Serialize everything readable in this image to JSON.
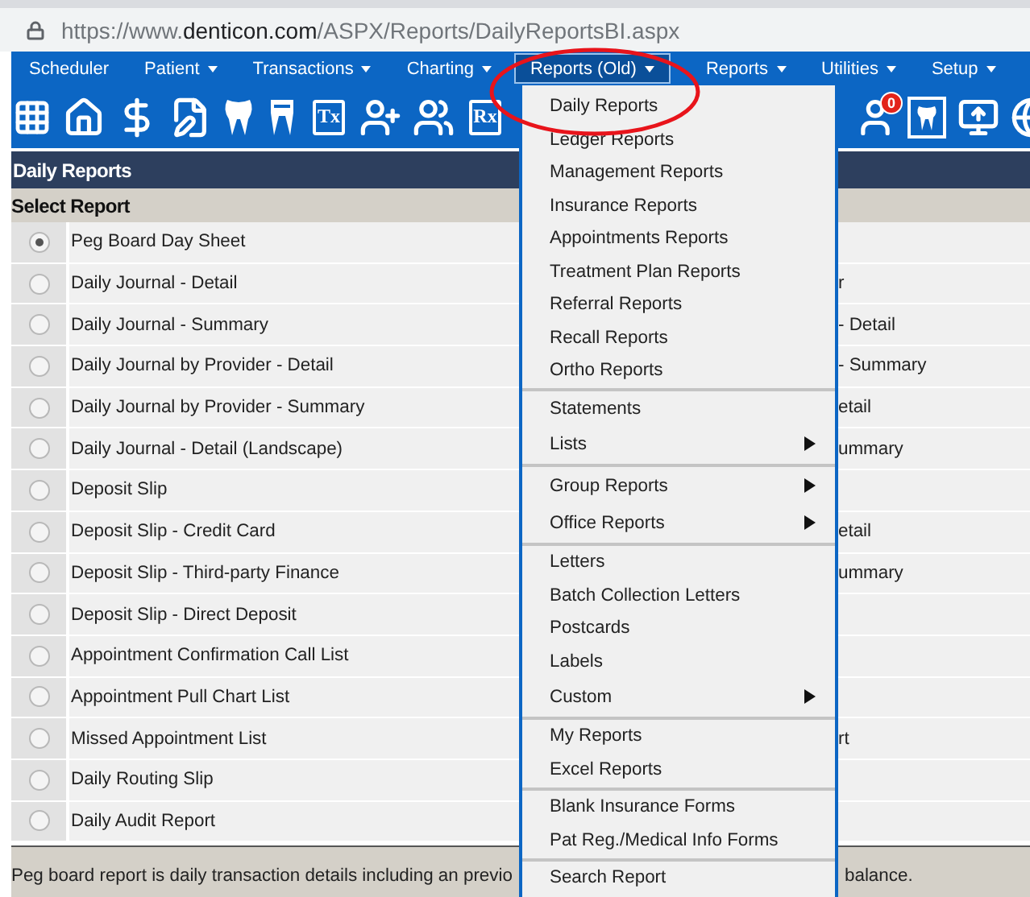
{
  "address_bar": {
    "url_parts": [
      {
        "text": "https://www.",
        "emphasis": false
      },
      {
        "text": "denticon.com",
        "emphasis": true
      },
      {
        "text": "/ASPX/Reports/DailyReportsBI.aspx",
        "emphasis": false
      }
    ]
  },
  "nav": [
    {
      "label": "Scheduler",
      "caret": false,
      "selected": false
    },
    {
      "label": "Patient",
      "caret": true,
      "selected": false
    },
    {
      "label": "Transactions",
      "caret": true,
      "selected": false
    },
    {
      "label": "Charting",
      "caret": true,
      "selected": false
    },
    {
      "label": "Reports (Old)",
      "caret": true,
      "selected": true
    },
    {
      "label": "Reports",
      "caret": true,
      "selected": false
    },
    {
      "label": "Utilities",
      "caret": true,
      "selected": false
    },
    {
      "label": "Setup",
      "caret": true,
      "selected": false
    }
  ],
  "toolbar_left": [
    {
      "kind": "calendar"
    },
    {
      "kind": "home"
    },
    {
      "kind": "dollar"
    },
    {
      "kind": "notes"
    },
    {
      "kind": "tooth"
    },
    {
      "kind": "crown"
    },
    {
      "kind": "tx",
      "label": "Tx"
    },
    {
      "kind": "user-plus"
    },
    {
      "kind": "users-plus"
    },
    {
      "kind": "rx",
      "label": "Rx"
    }
  ],
  "toolbar_right": [
    {
      "kind": "user-badge",
      "label": "0"
    },
    {
      "kind": "tooth-frame"
    },
    {
      "kind": "monitor-arrow"
    },
    {
      "kind": "globe"
    }
  ],
  "panel_title": "Daily Reports",
  "list_header": "Select Report",
  "reports": [
    {
      "label": "Peg Board Day Sheet",
      "selected": true
    },
    {
      "label": "Daily Journal - Detail",
      "selected": false,
      "column_2": "r"
    },
    {
      "label": "Daily Journal - Summary",
      "selected": false,
      "column_2": "- Detail"
    },
    {
      "label": "Daily Journal by Provider - Detail",
      "selected": false,
      "column_2": "- Summary"
    },
    {
      "label": "Daily Journal by Provider - Summary",
      "selected": false,
      "column_2": "etail"
    },
    {
      "label": "Daily Journal - Detail (Landscape)",
      "selected": false,
      "column_2": "ummary"
    },
    {
      "label": "Deposit Slip",
      "selected": false
    },
    {
      "label": "Deposit Slip - Credit Card",
      "selected": false,
      "column_2": "etail"
    },
    {
      "label": "Deposit Slip - Third-party Finance",
      "selected": false,
      "column_2": "ummary"
    },
    {
      "label": "Deposit Slip - Direct Deposit",
      "selected": false
    },
    {
      "label": "Appointment Confirmation Call List",
      "selected": false
    },
    {
      "label": "Appointment Pull Chart List",
      "selected": false
    },
    {
      "label": "Missed Appointment List",
      "selected": false,
      "column_2": "rt"
    },
    {
      "label": "Daily Routing Slip",
      "selected": false
    },
    {
      "label": "Daily Audit Report",
      "selected": false
    }
  ],
  "description": {
    "text": "Peg board report is daily transaction details including an previo",
    "text_2": "balance."
  },
  "menu": {
    "groups": [
      {
        "items": [
          {
            "label": "Daily Reports",
            "submenu": false
          },
          {
            "label": "Ledger Reports",
            "submenu": false
          },
          {
            "label": "Management Reports",
            "submenu": false
          },
          {
            "label": "Insurance Reports",
            "submenu": false
          },
          {
            "label": "Appointments Reports",
            "submenu": false
          },
          {
            "label": "Treatment Plan Reports",
            "submenu": false
          },
          {
            "label": "Referral Reports",
            "submenu": false
          },
          {
            "label": "Recall Reports",
            "submenu": false
          },
          {
            "label": "Ortho Reports",
            "submenu": false
          }
        ]
      },
      {
        "items": [
          {
            "label": "Statements",
            "submenu": false
          },
          {
            "label": "Lists",
            "submenu": true
          }
        ]
      },
      {
        "items": [
          {
            "label": "Group Reports",
            "submenu": true
          },
          {
            "label": "Office Reports",
            "submenu": true
          }
        ]
      },
      {
        "items": [
          {
            "label": "Letters",
            "submenu": false
          },
          {
            "label": "Batch Collection Letters",
            "submenu": false
          },
          {
            "label": "Postcards",
            "submenu": false
          },
          {
            "label": "Labels",
            "submenu": false
          },
          {
            "label": "Custom",
            "submenu": true
          }
        ]
      },
      {
        "items": [
          {
            "label": "My Reports",
            "submenu": false
          },
          {
            "label": "Excel Reports",
            "submenu": false
          }
        ]
      },
      {
        "items": [
          {
            "label": "Blank Insurance Forms",
            "submenu": false
          },
          {
            "label": "Pat Reg./Medical Info Forms",
            "submenu": false
          }
        ]
      },
      {
        "items": [
          {
            "label": "Search Report",
            "submenu": false
          }
        ]
      }
    ]
  },
  "annotation": {
    "kind": "ellipse"
  }
}
